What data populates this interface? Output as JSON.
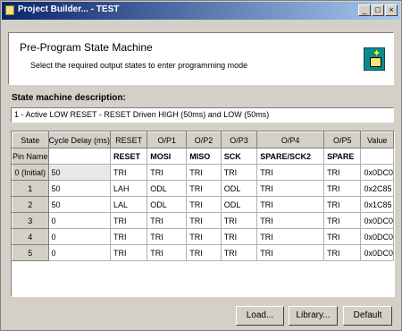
{
  "window": {
    "title": "Project Builder... - TEST"
  },
  "header": {
    "title": "Pre-Program State Machine",
    "subtitle": "Select the required output states to enter programming mode"
  },
  "description": {
    "label": "State machine description:",
    "value": "1 - Active LOW RESET - RESET Driven HIGH (50ms) and LOW (50ms)"
  },
  "grid": {
    "columns": [
      "State",
      "Cycle Delay (ms)",
      "RESET",
      "O/P1",
      "O/P2",
      "O/P3",
      "O/P4",
      "O/P5",
      "Value"
    ],
    "pin_row": {
      "label": "Pin Name",
      "cells": [
        "",
        "RESET",
        "MOSI",
        "MISO",
        "SCK",
        "SPARE/SCK2",
        "SPARE",
        ""
      ]
    },
    "rows": [
      {
        "state": "0 (Initial)",
        "cells": [
          "50",
          "TRI",
          "TRI",
          "TRI",
          "TRI",
          "TRI",
          "TRI",
          "0x0DC0"
        ]
      },
      {
        "state": "1",
        "cells": [
          "50",
          "LAH",
          "ODL",
          "TRI",
          "ODL",
          "TRI",
          "TRI",
          "0x2C85"
        ]
      },
      {
        "state": "2",
        "cells": [
          "50",
          "LAL",
          "ODL",
          "TRI",
          "ODL",
          "TRI",
          "TRI",
          "0x1C85"
        ]
      },
      {
        "state": "3",
        "cells": [
          "0",
          "TRI",
          "TRI",
          "TRI",
          "TRI",
          "TRI",
          "TRI",
          "0x0DC0"
        ]
      },
      {
        "state": "4",
        "cells": [
          "0",
          "TRI",
          "TRI",
          "TRI",
          "TRI",
          "TRI",
          "TRI",
          "0x0DC0"
        ]
      },
      {
        "state": "5",
        "cells": [
          "0",
          "TRI",
          "TRI",
          "TRI",
          "TRI",
          "TRI",
          "TRI",
          "0x0DC0"
        ]
      }
    ]
  },
  "buttons": {
    "load": "Load...",
    "library": "Library...",
    "default": "Default"
  },
  "titlebar_buttons": {
    "minimize": "_",
    "maximize": "□",
    "close": "×"
  },
  "colors": {
    "titlebar_start": "#0a246a",
    "titlebar_end": "#a6caf0",
    "face": "#d4d0c8"
  },
  "icons": {
    "app": "app-icon",
    "wizard": "chip-wizard-icon"
  }
}
